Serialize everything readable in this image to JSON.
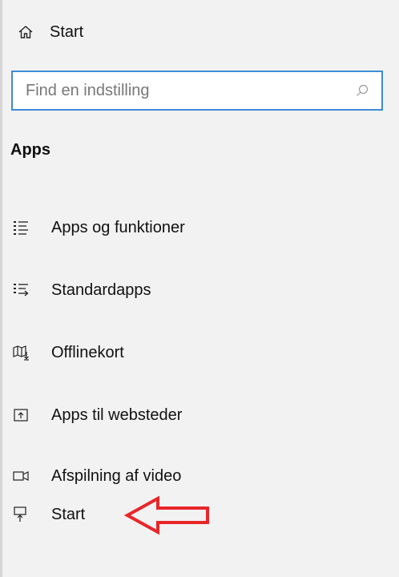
{
  "header": {
    "home_icon": "home-icon",
    "home_label": "Start"
  },
  "search": {
    "placeholder": "Find en indstilling",
    "value": "",
    "icon": "search-icon"
  },
  "section": {
    "title": "Apps"
  },
  "nav": {
    "items": [
      {
        "label": "Apps og funktioner",
        "icon": "apps-features-icon"
      },
      {
        "label": "Standardapps",
        "icon": "default-apps-icon"
      },
      {
        "label": "Offlinekort",
        "icon": "offline-maps-icon"
      },
      {
        "label": "Apps til websteder",
        "icon": "apps-for-websites-icon"
      },
      {
        "label": "Afspilning af video",
        "icon": "video-playback-icon"
      },
      {
        "label": "Start",
        "icon": "startup-icon"
      }
    ]
  },
  "annotation": {
    "arrow_color": "#e8262a",
    "icon": "red-arrow-left-icon"
  },
  "colors": {
    "background": "#f2f2f2",
    "accent": "#3d8bd6",
    "text": "#111111"
  }
}
